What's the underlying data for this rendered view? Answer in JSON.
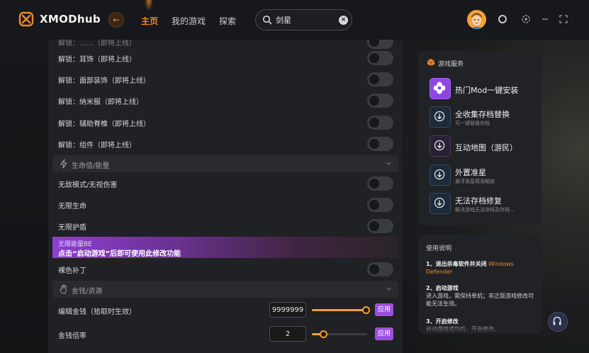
{
  "app": {
    "brand": "XMODhub"
  },
  "nav": {
    "home": "主页",
    "my_games": "我的游戏",
    "explore": "探索"
  },
  "search": {
    "value": "剑星",
    "placeholder": ""
  },
  "colors": {
    "accent_orange": "#f4851e",
    "accent_purple": "#9b4fe0",
    "panel": "#202124"
  },
  "mods": {
    "partial_row_label": "解锁：……（即将上线）",
    "unlock_rows": [
      "解锁：耳饰（即将上线）",
      "解锁：面部装饰（即将上线）",
      "解锁：纳米服（即将上线）",
      "解锁：辅助脊椎（即将上线）",
      "解锁：组件（即将上线）"
    ],
    "sections": {
      "health": "生命值/能量",
      "money": "金钱/资源"
    },
    "health_rows": [
      "无敌模式/无视伤害",
      "无限生命",
      "无限护盾"
    ],
    "banner": {
      "title": "无限能量BE",
      "notice": "点击“启动游戏”后即可使用此修改功能"
    },
    "skin_row": "裸色补丁",
    "money_rows": [
      {
        "label": "编辑金钱（拾取时生效）",
        "value": "9999999",
        "slider_fraction": 0.97,
        "apply": "应用"
      },
      {
        "label": "金钱倍率",
        "value": "2",
        "slider_fraction": 0.2,
        "apply": "应用"
      }
    ]
  },
  "services": {
    "title": "游戏服务",
    "items": [
      {
        "name": "热门Mod一键安装",
        "sub": "",
        "icon": "flower-icon"
      },
      {
        "name": "全收集存档替换",
        "sub": "可一键替换存档",
        "icon": "download-icon"
      },
      {
        "name": "互动地图（游民）",
        "sub": "",
        "icon": "download-icon"
      },
      {
        "name": "外置准星",
        "sub": "悬浮准星精准瞄放",
        "icon": "download-icon"
      },
      {
        "name": "无法存档修复",
        "sub": "解决游戏无法存档及存档...",
        "icon": "download-icon"
      }
    ]
  },
  "usage": {
    "title": "使用说明",
    "steps": [
      {
        "head": "1、退出杀毒软件并关闭",
        "highlight": "Windows Defender",
        "body": ""
      },
      {
        "head": "2、启动游戏",
        "highlight": "",
        "body": "进入游戏，需保持单机；非正版游戏修改可能无法生效。"
      },
      {
        "head": "3、开启修改",
        "highlight": "",
        "body": "启动游戏成功后，开启修改。"
      }
    ]
  }
}
